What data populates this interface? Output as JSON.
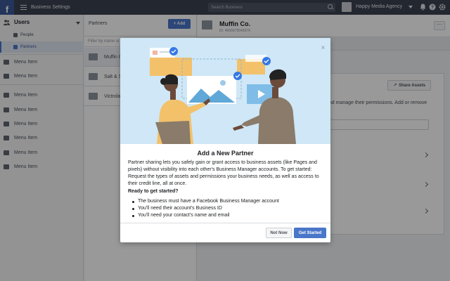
{
  "topbar": {
    "logo": "f",
    "app_title": "Business Settings",
    "search_placeholder": "Search Business",
    "agency_name": "Happy Media Agency",
    "icons": [
      "bell-icon",
      "question-icon",
      "settings-icon"
    ]
  },
  "sidebar": {
    "section_label": "Users",
    "sub_items": [
      {
        "label": "People",
        "active": false
      },
      {
        "label": "Partners",
        "active": true
      }
    ],
    "menu_items": [
      "Menu Item",
      "Menu Item",
      "Menu Item",
      "Menu Item",
      "Menu Item",
      "Menu Item",
      "Menu Item",
      "Menu Item"
    ]
  },
  "partners": {
    "heading": "Partners",
    "add_label": "+ Add",
    "filter_placeholder": "Filter by name or ID",
    "rows": [
      "Muffin Co.",
      "Salt & Straw",
      "Victrola"
    ]
  },
  "main": {
    "title": "Muffin Co.",
    "id_text": "ID: 4606679543679",
    "more_label": "···",
    "share_label": "Share Assets",
    "text": "and manage their permissions. Add or remove"
  },
  "modal": {
    "title": "Add a New Partner",
    "description": "Partner sharing lets you safely gain or grant access to business assets (like Pages and pixels) without visibility into each other's Business Manager accounts. To get started: Request the types of assets and permissions your business needs, as well as access to their credit line, all at once.",
    "ready": "Ready to get started?",
    "requirements": [
      "The business must have a Facebook Business Manager account",
      "You'll need their account's Business ID",
      "You'll need your contact's name and email"
    ],
    "not_now_label": "Not Now",
    "get_started_label": "Get Started",
    "close_label": "×"
  },
  "colors": {
    "topbar": "#3b4250",
    "accent": "#4a76c9",
    "illustration_bg": "#cfe7f6"
  }
}
